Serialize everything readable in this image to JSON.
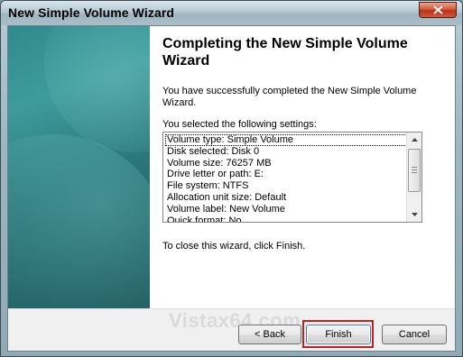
{
  "window": {
    "title": "New Simple Volume Wizard"
  },
  "content": {
    "heading": "Completing the New Simple Volume Wizard",
    "success_text": "You have successfully completed the New Simple Volume Wizard.",
    "settings_intro": "You selected the following settings:",
    "settings": [
      "Volume type: Simple Volume",
      "Disk selected: Disk 0",
      "Volume size: 76257 MB",
      "Drive letter or path: E:",
      "File system: NTFS",
      "Allocation unit size: Default",
      "Volume label: New Volume",
      "Quick format: No"
    ],
    "close_text": "To close this wizard, click Finish."
  },
  "footer": {
    "watermark": "Vistax64.com",
    "back_label": "< Back",
    "finish_label": "Finish",
    "cancel_label": "Cancel"
  },
  "colors": {
    "highlight": "#c81e1e",
    "side_panel": "#2a7678"
  }
}
